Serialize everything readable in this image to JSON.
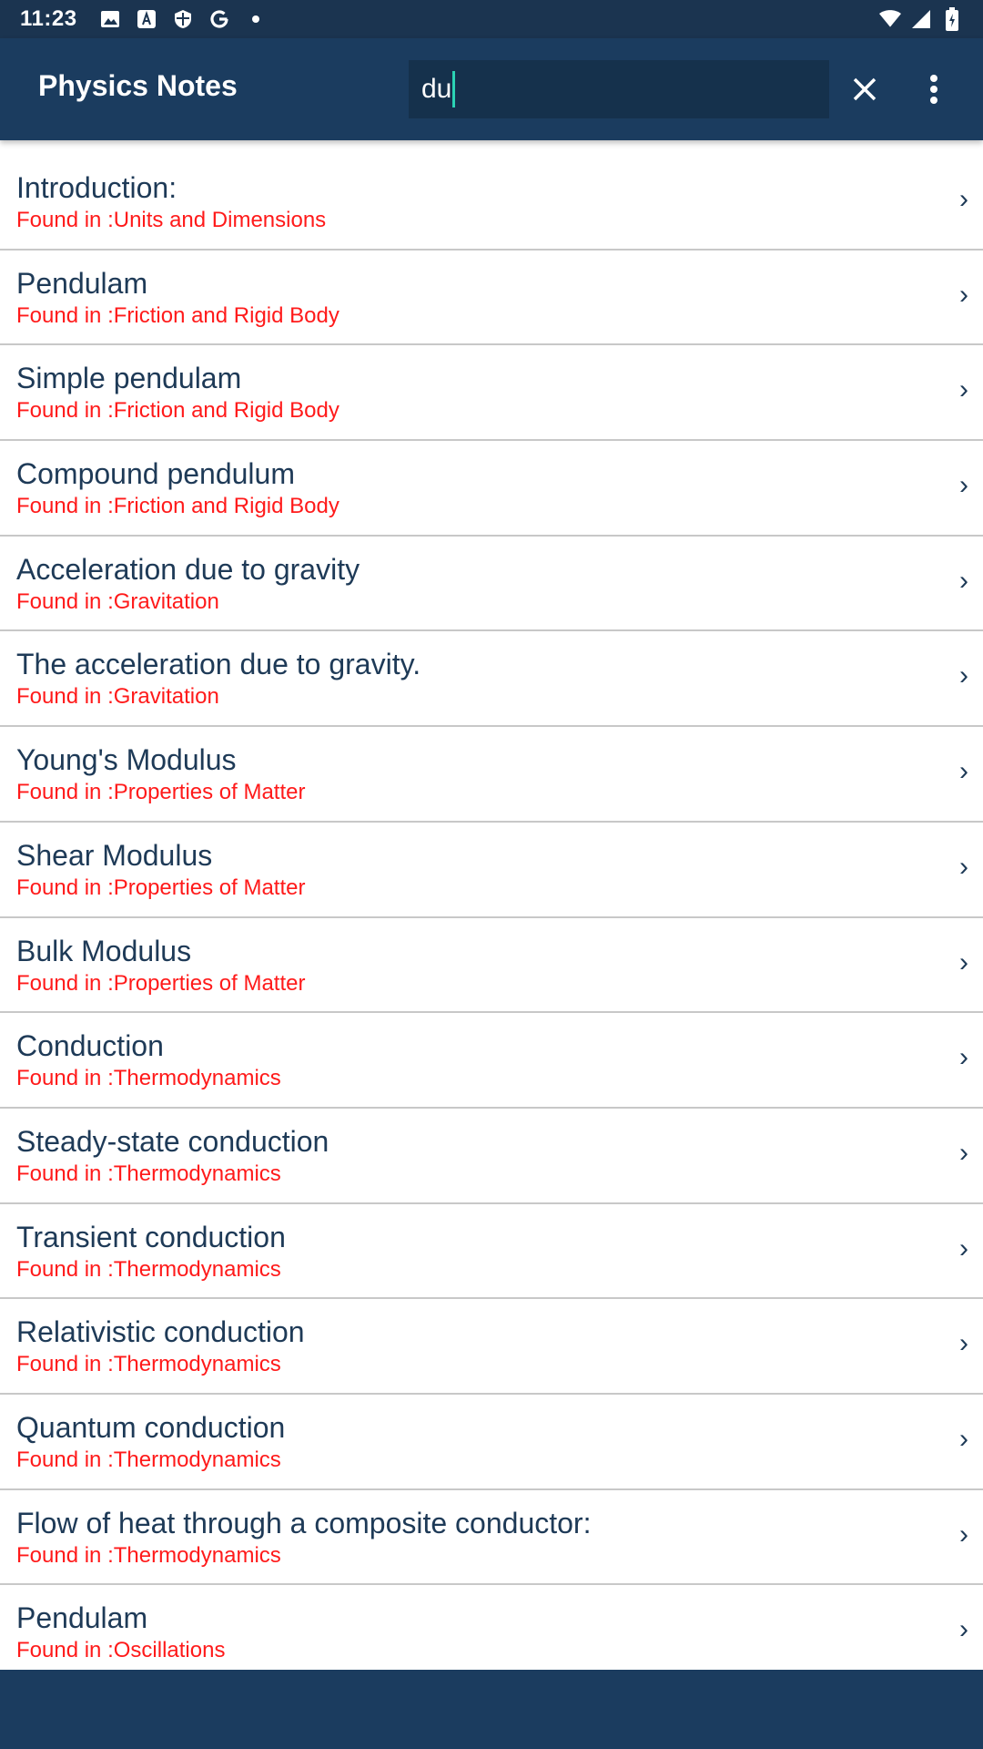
{
  "status_bar": {
    "time": "11:23",
    "left_icons": [
      "image-icon",
      "font-icon",
      "shield-icon",
      "google-icon",
      "dot-icon"
    ],
    "right_icons": [
      "wifi-icon",
      "signal-icon",
      "battery-icon"
    ]
  },
  "app_bar": {
    "title": "Physics Notes",
    "search_value": "du",
    "clear_icon": "close-icon",
    "menu_icon": "more-vert-icon"
  },
  "results": [
    {
      "title": "Introduction:",
      "found_in": "Found in :Units and Dimensions"
    },
    {
      "title": "Pendulam",
      "found_in": "Found in :Friction and Rigid Body"
    },
    {
      "title": "Simple pendulam",
      "found_in": "Found in :Friction and Rigid Body"
    },
    {
      "title": "Compound pendulum",
      "found_in": "Found in :Friction and Rigid Body"
    },
    {
      "title": "Acceleration due to gravity",
      "found_in": "Found in :Gravitation"
    },
    {
      "title": "The acceleration due to gravity.",
      "found_in": "Found in :Gravitation"
    },
    {
      "title": "Young's Modulus",
      "found_in": "Found in :Properties of Matter"
    },
    {
      "title": "Shear Modulus",
      "found_in": "Found in :Properties of Matter"
    },
    {
      "title": "Bulk Modulus",
      "found_in": "Found in :Properties of Matter"
    },
    {
      "title": "Conduction",
      "found_in": "Found in :Thermodynamics"
    },
    {
      "title": "Steady-state conduction",
      "found_in": "Found in :Thermodynamics"
    },
    {
      "title": "Transient conduction",
      "found_in": "Found in :Thermodynamics"
    },
    {
      "title": "Relativistic conduction",
      "found_in": "Found in :Thermodynamics"
    },
    {
      "title": "Quantum conduction",
      "found_in": "Found in :Thermodynamics"
    },
    {
      "title": "Flow of heat through a composite conductor:",
      "found_in": "Found in :Thermodynamics"
    },
    {
      "title": "Pendulam",
      "found_in": "Found in :Oscillations"
    }
  ],
  "chevron": "›",
  "colors": {
    "status_bar": "#1b3450",
    "app_bar": "#1b3c5f",
    "title_text": "#1e3a57",
    "found_in_text": "#ff1a1a",
    "cursor": "#2bd3b4"
  }
}
